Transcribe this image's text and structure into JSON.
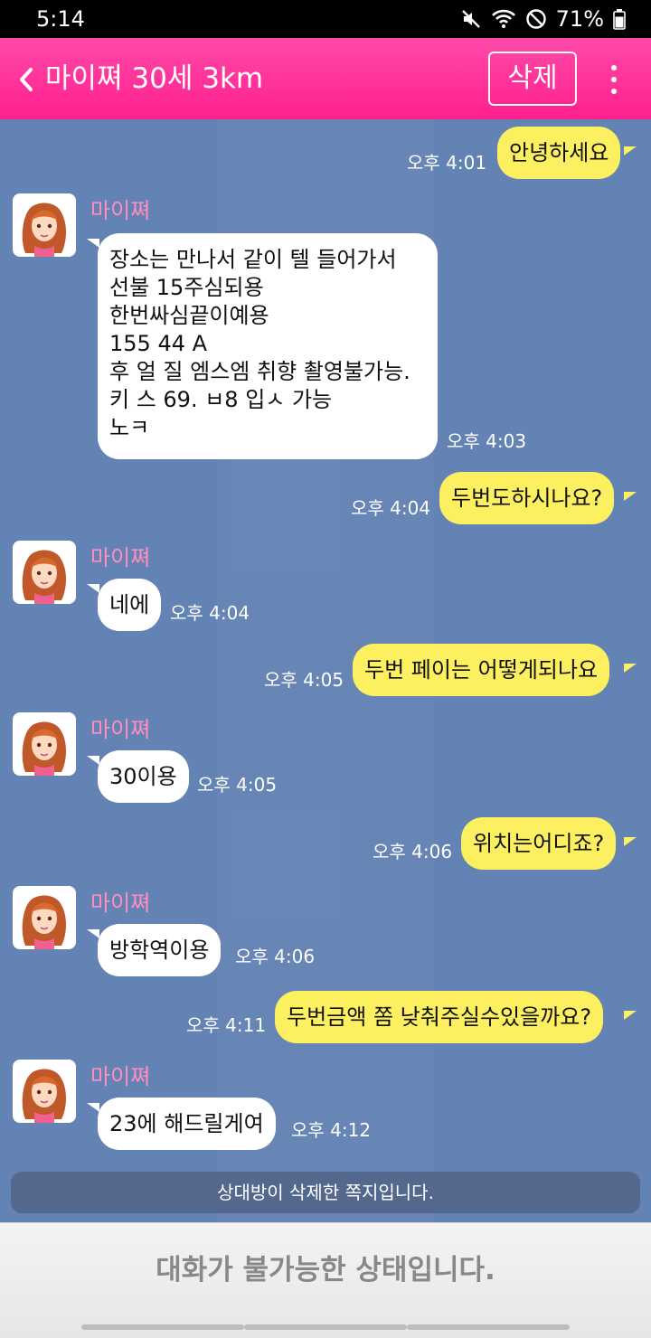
{
  "status_bar": {
    "time": "5:14",
    "battery": "71%",
    "icons": [
      "mute-icon",
      "wifi-icon",
      "dnd-icon",
      "battery-icon"
    ]
  },
  "header": {
    "title": "마이쪄 30세 3km",
    "delete_label": "삭제",
    "back_icon": "chevron-left-icon",
    "more_icon": "more-vertical-icon"
  },
  "colors": {
    "header": "#ff2b96",
    "chat_background": "#6383b4",
    "my_bubble": "#fcf061",
    "their_bubble": "#ffffff",
    "sender_name": "#ff8fc0"
  },
  "messages": [
    {
      "from": "me",
      "text": "안녕하세요",
      "time": "오후 4:01"
    },
    {
      "from": "them",
      "sender": "마이쪄",
      "lines": [
        "장소는 만나서 같이 텔 들어가서",
        "선불 15주심되용",
        "한번싸심끝이예용",
        "155 44 A",
        "후 얼 질 엠스엠 취향 촬영불가능.",
        "키 스 69. ㅂ8 입ㅅ 가능",
        "노ㅋ"
      ],
      "time": "오후 4:03"
    },
    {
      "from": "me",
      "text": "두번도하시나요?",
      "time": "오후 4:04"
    },
    {
      "from": "them",
      "sender": "마이쪄",
      "text": "네에",
      "time": "오후 4:04"
    },
    {
      "from": "me",
      "text": "두번 페이는 어떻게되나요",
      "time": "오후 4:05"
    },
    {
      "from": "them",
      "sender": "마이쪄",
      "text": "30이용",
      "time": "오후 4:05"
    },
    {
      "from": "me",
      "text": "위치는어디죠?",
      "time": "오후 4:06"
    },
    {
      "from": "them",
      "sender": "마이쪄",
      "text": "방학역이용",
      "time": "오후 4:06"
    },
    {
      "from": "me",
      "text": "두번금액 쫌 낮춰주실수있을까요?",
      "time": "오후 4:11"
    },
    {
      "from": "them",
      "sender": "마이쪄",
      "text": "23에 해드릴게여",
      "time": "오후 4:12"
    }
  ],
  "notice": "상대방이 삭제한 쪽지입니다.",
  "footer": "대화가 불가능한 상태입니다."
}
